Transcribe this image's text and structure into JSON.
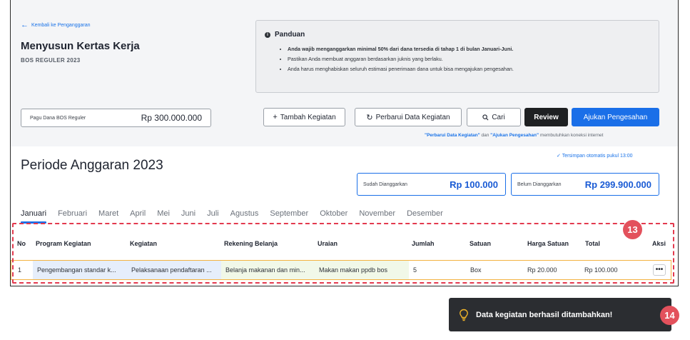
{
  "header": {
    "back_label": "Kembali ke Penganggaran",
    "title": "Menyusun Kertas Kerja",
    "subtitle": "BOS REGULER 2023"
  },
  "guide": {
    "title": "Panduan",
    "items": [
      "Anda wajib menganggarkan minimal 50% dari dana tersedia di tahap 1 di bulan Januari-Juni.",
      "Pastikan Anda membuat anggaran berdasarkan juknis yang berlaku.",
      "Anda harus menghabiskan seluruh estimasi penerimaan dana untuk bisa mengajukan pengesahan."
    ]
  },
  "budget": {
    "label": "Pagu Dana BOS Reguler",
    "value": "Rp 300.000.000"
  },
  "toolbar": {
    "add_label": "Tambah Kegiatan",
    "refresh_label": "Perbarui Data Kegiatan",
    "search_label": "Cari",
    "review_label": "Review",
    "submit_label": "Ajukan Pengesahan"
  },
  "connect_note": {
    "part1": "\"Perbarui Data Kegiatan\"",
    "part2": " dan ",
    "part3": "\"Ajukan Pengesahan\"",
    "part4": " membutuhkan koneksi internet"
  },
  "autosave": "Tersimpan otomatis pukul 13:00",
  "period_title": "Periode Anggaran 2023",
  "summary": {
    "budgeted_label": "Sudah Dianggarkan",
    "budgeted_value": "Rp 100.000",
    "unbudgeted_label": "Belum Dianggarkan",
    "unbudgeted_value": "Rp 299.900.000"
  },
  "months": [
    "Januari",
    "Februari",
    "Maret",
    "April",
    "Mei",
    "Juni",
    "Juli",
    "Agustus",
    "September",
    "Oktober",
    "November",
    "Desember"
  ],
  "active_month": "Januari",
  "table": {
    "headers": {
      "no": "No",
      "program": "Program Kegiatan",
      "kegiatan": "Kegiatan",
      "rekening": "Rekening Belanja",
      "uraian": "Uraian",
      "jumlah": "Jumlah",
      "satuan": "Satuan",
      "harga": "Harga Satuan",
      "total": "Total",
      "aksi": "Aksi"
    },
    "rows": [
      {
        "no": "1",
        "program": "Pengembangan standar k...",
        "kegiatan": "Pelaksanaan pendaftaran ...",
        "rekening": "Belanja makanan dan min...",
        "uraian": "Makan makan ppdb bos",
        "jumlah": "5",
        "satuan": "Box",
        "harga": "Rp 20.000",
        "total": "Rp 100.000",
        "action": "•••"
      }
    ]
  },
  "annotations": {
    "step_table": "13",
    "step_toast": "14"
  },
  "toast": {
    "message": "Data kegiatan berhasil ditambahkan!"
  },
  "colors": {
    "primary": "#1a6fe8",
    "annotation": "#e3515c",
    "row_highlight_border": "#f3b341",
    "toast_bg": "#2b2d31"
  }
}
